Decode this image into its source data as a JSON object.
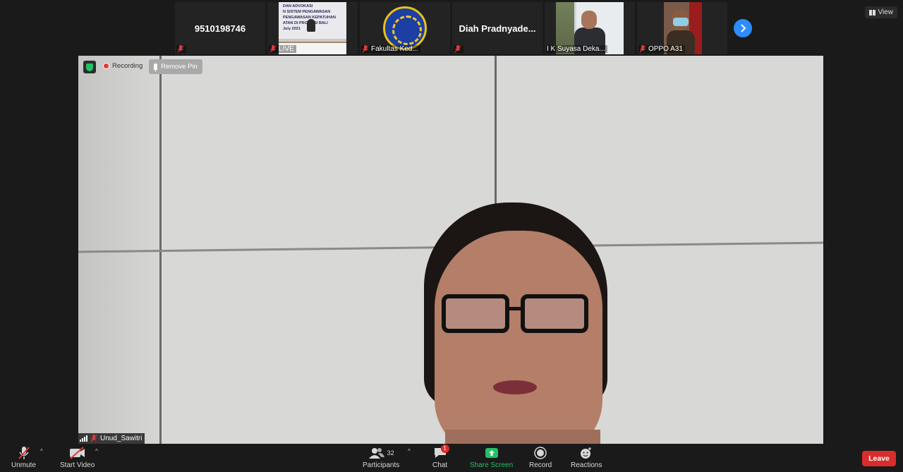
{
  "filmstrip": [
    {
      "name": "9510198746",
      "label": ""
    },
    {
      "name": "",
      "label": "LIVE",
      "image_text": "DAN ADVOKASI\nN SISTEM PENGAWASAN\nPENGAWASAN KEPATUHAN\nATAN DI PROVINSI BALI\nJuly 2021"
    },
    {
      "name": "",
      "label": "Fakultas Ked..."
    },
    {
      "name": "Diah  Pradnyade...",
      "label": ""
    },
    {
      "name": "",
      "label": "I K Suyasa Deka..."
    },
    {
      "name": "",
      "label": "OPPO A31"
    }
  ],
  "view_label": "View",
  "main": {
    "recording_label": "Recording",
    "remove_pin_label": "Remove Pin",
    "speaker_name": "Unud_Sawitri"
  },
  "toolbar": {
    "unmute": "Unmute",
    "start_video": "Start Video",
    "participants": "Participants",
    "participants_count": "32",
    "chat": "Chat",
    "chat_badge": "1",
    "share_screen": "Share Screen",
    "record": "Record",
    "reactions": "Reactions",
    "leave": "Leave"
  },
  "colors": {
    "share_green": "#23c164",
    "leave_red": "#d92c2c",
    "accent_blue": "#2d8cff"
  }
}
